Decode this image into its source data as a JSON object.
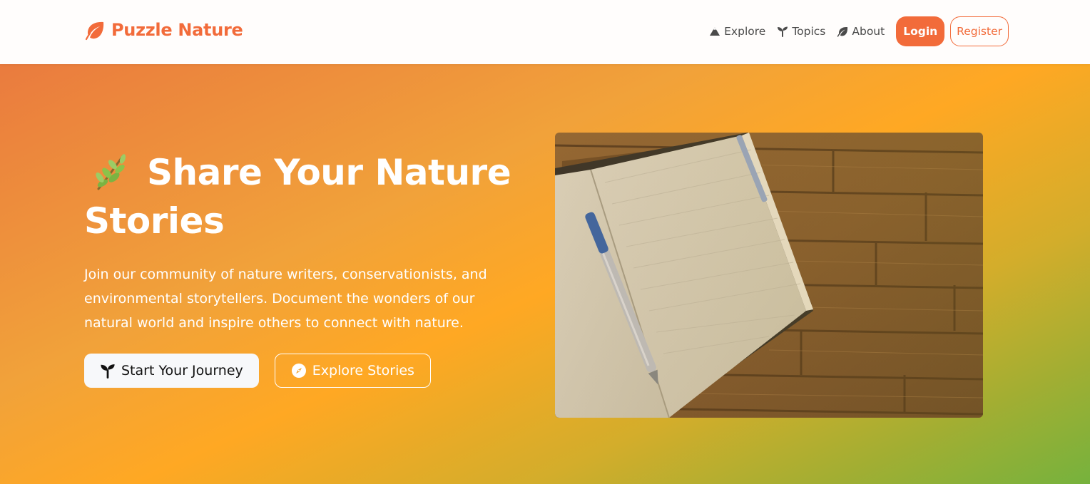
{
  "nav": {
    "brand": "Puzzle Nature",
    "links": [
      {
        "label": "Explore",
        "icon": "mountain-icon"
      },
      {
        "label": "Topics",
        "icon": "seedling-icon"
      },
      {
        "label": "About",
        "icon": "leaf-icon"
      }
    ],
    "login_label": "Login",
    "register_label": "Register"
  },
  "hero": {
    "title_line1": "Share Your Nature",
    "title_line2": "Stories",
    "title_icon": "herb-emoji",
    "description": "Join our community of nature writers, conservationists, and environmental storytellers. Document the wonders of our natural world and inspire others to connect with nature.",
    "primary_button": "Start Your Journey",
    "primary_icon": "seedling-icon",
    "secondary_button": "Explore Stories",
    "secondary_icon": "compass-icon",
    "image": "open-notebook-with-pen-on-wooden-table"
  },
  "colors": {
    "brand": "#f26b3a",
    "hero_gradient_start": "#ea7b3e",
    "hero_gradient_mid": "#ffa823",
    "hero_gradient_end": "#76b23d"
  }
}
